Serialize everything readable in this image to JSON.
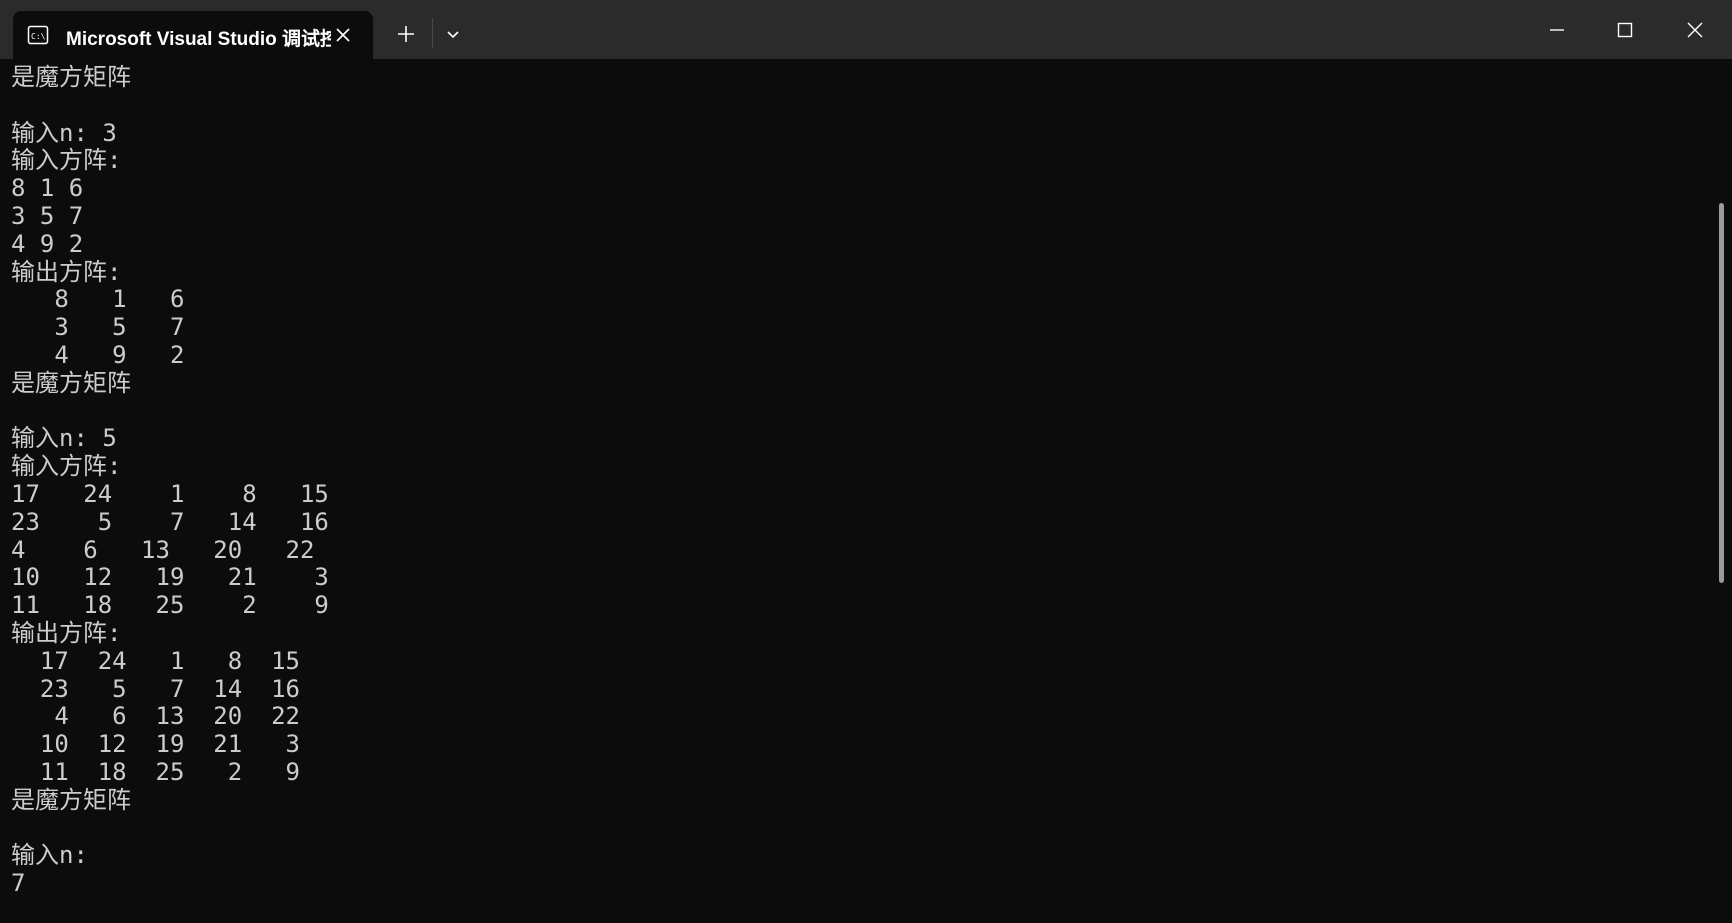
{
  "window": {
    "tab_title": "Microsoft Visual Studio 调试控制台",
    "icon": "console-app-icon",
    "close_tab_icon": "close-icon",
    "new_tab_icon": "plus-icon",
    "dropdown_icon": "chevron-down-icon",
    "controls": [
      "minimize-icon",
      "maximize-icon",
      "close-icon"
    ]
  },
  "colors": {
    "background": "#0c0c0c",
    "titlebar": "#2b2b2b",
    "text": "#cccccc"
  },
  "console": {
    "lines": [
      "是魔方矩阵",
      "",
      "输入n: 3",
      "输入方阵:",
      "8 1 6",
      "3 5 7",
      "4 9 2",
      "输出方阵:",
      "   8   1   6",
      "   3   5   7",
      "   4   9   2",
      "是魔方矩阵",
      "",
      "输入n: 5",
      "输入方阵:",
      "17   24    1    8   15",
      "23    5    7   14   16",
      "4    6   13   20   22",
      "10   12   19   21    3",
      "11   18   25    2    9",
      "输出方阵:",
      "  17  24   1   8  15",
      "  23   5   7  14  16",
      "   4   6  13  20  22",
      "  10  12  19  21   3",
      "  11  18  25   2   9",
      "是魔方矩阵",
      "",
      "输入n:",
      "7"
    ]
  },
  "scrollbar": {
    "position": 0.17
  }
}
